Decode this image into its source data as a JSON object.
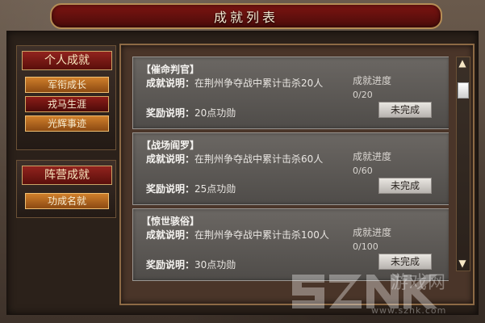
{
  "header": {
    "title": "成就列表"
  },
  "sidebar": {
    "personal": {
      "label": "个人成就",
      "items": [
        {
          "label": "军衔成长"
        },
        {
          "label": "戎马生涯"
        },
        {
          "label": "光辉事迹"
        }
      ]
    },
    "camp": {
      "label": "阵营成就",
      "items": [
        {
          "label": "功成名就"
        }
      ]
    }
  },
  "achievements": [
    {
      "title": "【催命判官】",
      "desc_label": "成就说明：",
      "desc": "在荆州争夺战中累计击杀20人",
      "reward_label": "奖励说明：",
      "reward": "20点功勋",
      "progress_label": "成就进度",
      "progress": "0/20",
      "status": "未完成"
    },
    {
      "title": "【战场阎罗】",
      "desc_label": "成就说明：",
      "desc": "在荆州争夺战中累计击杀60人",
      "reward_label": "奖励说明：",
      "reward": "25点功勋",
      "progress_label": "成就进度",
      "progress": "0/60",
      "status": "未完成"
    },
    {
      "title": "【惊世骇俗】",
      "desc_label": "成就说明：",
      "desc": "在荆州争夺战中累计击杀100人",
      "reward_label": "奖励说明：",
      "reward": "30点功勋",
      "progress_label": "成就进度",
      "progress": "0/100",
      "status": "未完成"
    }
  ],
  "scrollbar": {
    "up_icon": "▲",
    "down_icon": "▼"
  },
  "watermark": {
    "text": "游戏网",
    "url": "www.sznk.com"
  },
  "colors": {
    "accent_red": "#7d1411",
    "gold_border": "#caa567",
    "orange_button": "#d07f2b"
  }
}
